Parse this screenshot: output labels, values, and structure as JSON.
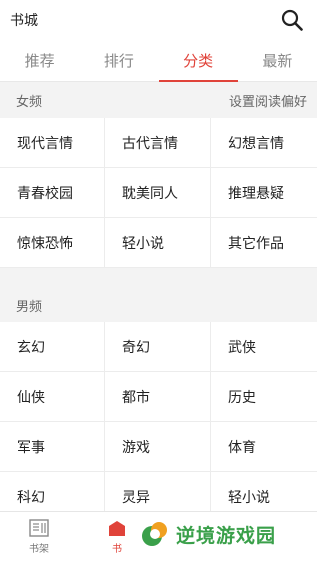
{
  "header": {
    "title": "书城",
    "search_icon": "search-icon"
  },
  "tabs": [
    {
      "label": "推荐",
      "active": false
    },
    {
      "label": "排行",
      "active": false
    },
    {
      "label": "分类",
      "active": true
    },
    {
      "label": "最新",
      "active": false
    }
  ],
  "female": {
    "heading": "女频",
    "settings_link": "设置阅读偏好",
    "categories": [
      "现代言情",
      "古代言情",
      "幻想言情",
      "青春校园",
      "耽美同人",
      "推理悬疑",
      "惊悚恐怖",
      "轻小说",
      "其它作品"
    ]
  },
  "male": {
    "heading": "男频",
    "categories": [
      "玄幻",
      "奇幻",
      "武侠",
      "仙侠",
      "都市",
      "历史",
      "军事",
      "游戏",
      "体育",
      "科幻",
      "灵异",
      "轻小说"
    ]
  },
  "bottom_nav": {
    "bookshelf_label": "书架",
    "bookstore_label": "书"
  },
  "watermark": {
    "text": "逆境游戏园"
  },
  "colors": {
    "accent": "#e0433a",
    "watermark": "#3aa04a"
  }
}
